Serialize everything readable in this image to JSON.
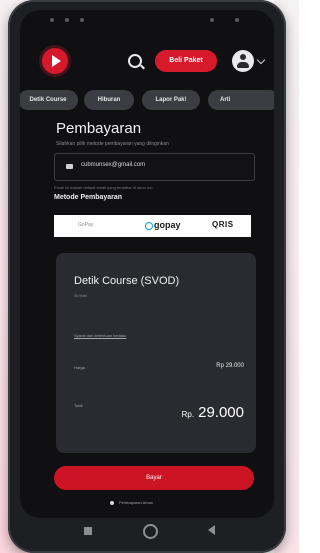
{
  "header": {
    "cta_label": "Beli Paket",
    "icons": [
      "logo",
      "search-icon",
      "user-icon",
      "chevron-down-icon"
    ]
  },
  "tabs": [
    {
      "label": "Detik Course"
    },
    {
      "label": "Hiburan"
    },
    {
      "label": "Lapor Pak!"
    },
    {
      "label": "Arti"
    }
  ],
  "page": {
    "title": "Pembayaran",
    "subtitle": "Silahkan pilih metode pembayaran yang diinginkan"
  },
  "email": {
    "value": "cubmunsex@gmail.com",
    "hint": "Email ini adalah default email yang terdaftar di akun mu"
  },
  "payment": {
    "label": "Metode Pembayaran",
    "option_text": "GoPay",
    "logos": [
      "gopay",
      "QRIS"
    ]
  },
  "order": {
    "course_name": "Detik Course (SVOD)",
    "duration": "30 Hari",
    "terms_link": "Syarat dan ketentuan berlaku",
    "price_label": "Harga",
    "price_value": "Rp 29.000",
    "total_label": "Total",
    "total_currency": "Rp.",
    "total_value": "29.000"
  },
  "actions": {
    "pay_label": "Bayar",
    "secure_note": "Pembayaran Aman"
  },
  "colors": {
    "accent": "#d61a2c",
    "background": "#101012",
    "card": "#2a2b30",
    "tab": "#3c3d42"
  }
}
